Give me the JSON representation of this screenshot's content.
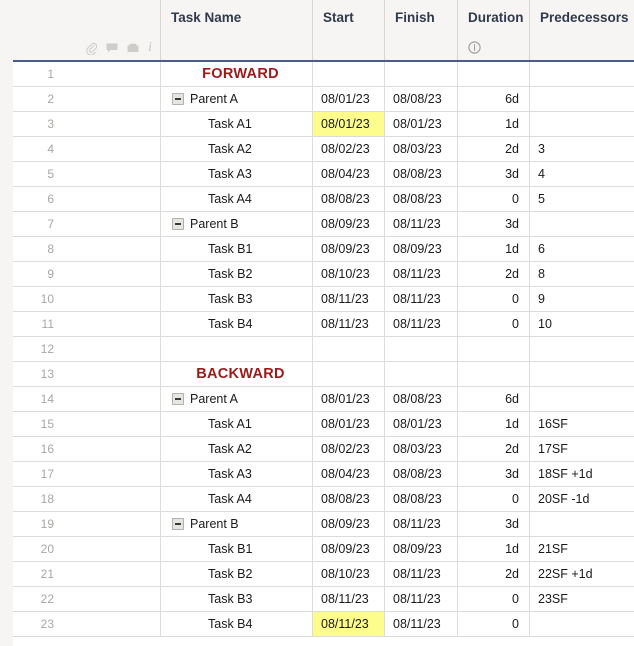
{
  "header": {
    "columns": [
      {
        "key": "rownum",
        "label": "",
        "icons": [
          "attachment-icon",
          "comment-icon",
          "proof-icon",
          "info-icon"
        ]
      },
      {
        "key": "name",
        "label": "Task Name",
        "icons": []
      },
      {
        "key": "start",
        "label": "Start",
        "icons": []
      },
      {
        "key": "finish",
        "label": "Finish",
        "icons": []
      },
      {
        "key": "duration",
        "label": "Duration",
        "icons": [
          "elapsed-duration-icon"
        ]
      },
      {
        "key": "predecessors",
        "label": "Predecessors",
        "icons": []
      }
    ],
    "task_name_label": "Task Name",
    "start_label": "Start",
    "finish_label": "Finish",
    "duration_label": "Duration",
    "predecessors_label": "Predecessors"
  },
  "colors": {
    "header_bg": "#f6f5f3",
    "header_underline": "#4a5d8a",
    "grid_line": "#dedcd8",
    "section_text": "#9b1b1b",
    "highlight": "#fdfd8e",
    "row_number": "#a9a7a3"
  },
  "rows": [
    {
      "num": "1",
      "name": "FORWARD",
      "level": "section",
      "start": "",
      "finish": "",
      "duration": "",
      "pred": "",
      "start_highlight": false
    },
    {
      "num": "2",
      "name": "Parent A",
      "level": "parent",
      "start": "08/01/23",
      "finish": "08/08/23",
      "duration": "6d",
      "pred": "",
      "start_highlight": false
    },
    {
      "num": "3",
      "name": "Task A1",
      "level": "child",
      "start": "08/01/23",
      "finish": "08/01/23",
      "duration": "1d",
      "pred": "",
      "start_highlight": true
    },
    {
      "num": "4",
      "name": "Task A2",
      "level": "child",
      "start": "08/02/23",
      "finish": "08/03/23",
      "duration": "2d",
      "pred": "3",
      "start_highlight": false
    },
    {
      "num": "5",
      "name": "Task A3",
      "level": "child",
      "start": "08/04/23",
      "finish": "08/08/23",
      "duration": "3d",
      "pred": "4",
      "start_highlight": false
    },
    {
      "num": "6",
      "name": "Task A4",
      "level": "child",
      "start": "08/08/23",
      "finish": "08/08/23",
      "duration": "0",
      "pred": "5",
      "start_highlight": false
    },
    {
      "num": "7",
      "name": "Parent B",
      "level": "parent",
      "start": "08/09/23",
      "finish": "08/11/23",
      "duration": "3d",
      "pred": "",
      "start_highlight": false
    },
    {
      "num": "8",
      "name": "Task B1",
      "level": "child",
      "start": "08/09/23",
      "finish": "08/09/23",
      "duration": "1d",
      "pred": "6",
      "start_highlight": false
    },
    {
      "num": "9",
      "name": "Task B2",
      "level": "child",
      "start": "08/10/23",
      "finish": "08/11/23",
      "duration": "2d",
      "pred": "8",
      "start_highlight": false
    },
    {
      "num": "10",
      "name": "Task B3",
      "level": "child",
      "start": "08/11/23",
      "finish": "08/11/23",
      "duration": "0",
      "pred": "9",
      "start_highlight": false
    },
    {
      "num": "11",
      "name": "Task B4",
      "level": "child",
      "start": "08/11/23",
      "finish": "08/11/23",
      "duration": "0",
      "pred": "10",
      "start_highlight": false
    },
    {
      "num": "12",
      "name": "",
      "level": "empty",
      "start": "",
      "finish": "",
      "duration": "",
      "pred": "",
      "start_highlight": false
    },
    {
      "num": "13",
      "name": "BACKWARD",
      "level": "section",
      "start": "",
      "finish": "",
      "duration": "",
      "pred": "",
      "start_highlight": false
    },
    {
      "num": "14",
      "name": "Parent A",
      "level": "parent",
      "start": "08/01/23",
      "finish": "08/08/23",
      "duration": "6d",
      "pred": "",
      "start_highlight": false
    },
    {
      "num": "15",
      "name": "Task A1",
      "level": "child",
      "start": "08/01/23",
      "finish": "08/01/23",
      "duration": "1d",
      "pred": "16SF",
      "start_highlight": false
    },
    {
      "num": "16",
      "name": "Task A2",
      "level": "child",
      "start": "08/02/23",
      "finish": "08/03/23",
      "duration": "2d",
      "pred": "17SF",
      "start_highlight": false
    },
    {
      "num": "17",
      "name": "Task A3",
      "level": "child",
      "start": "08/04/23",
      "finish": "08/08/23",
      "duration": "3d",
      "pred": "18SF +1d",
      "start_highlight": false
    },
    {
      "num": "18",
      "name": "Task A4",
      "level": "child",
      "start": "08/08/23",
      "finish": "08/08/23",
      "duration": "0",
      "pred": "20SF -1d",
      "start_highlight": false
    },
    {
      "num": "19",
      "name": "Parent B",
      "level": "parent",
      "start": "08/09/23",
      "finish": "08/11/23",
      "duration": "3d",
      "pred": "",
      "start_highlight": false
    },
    {
      "num": "20",
      "name": "Task B1",
      "level": "child",
      "start": "08/09/23",
      "finish": "08/09/23",
      "duration": "1d",
      "pred": "21SF",
      "start_highlight": false
    },
    {
      "num": "21",
      "name": "Task B2",
      "level": "child",
      "start": "08/10/23",
      "finish": "08/11/23",
      "duration": "2d",
      "pred": "22SF +1d",
      "start_highlight": false
    },
    {
      "num": "22",
      "name": "Task B3",
      "level": "child",
      "start": "08/11/23",
      "finish": "08/11/23",
      "duration": "0",
      "pred": "23SF",
      "start_highlight": false
    },
    {
      "num": "23",
      "name": "Task B4",
      "level": "child",
      "start": "08/11/23",
      "finish": "08/11/23",
      "duration": "0",
      "pred": "",
      "start_highlight": true
    }
  ]
}
